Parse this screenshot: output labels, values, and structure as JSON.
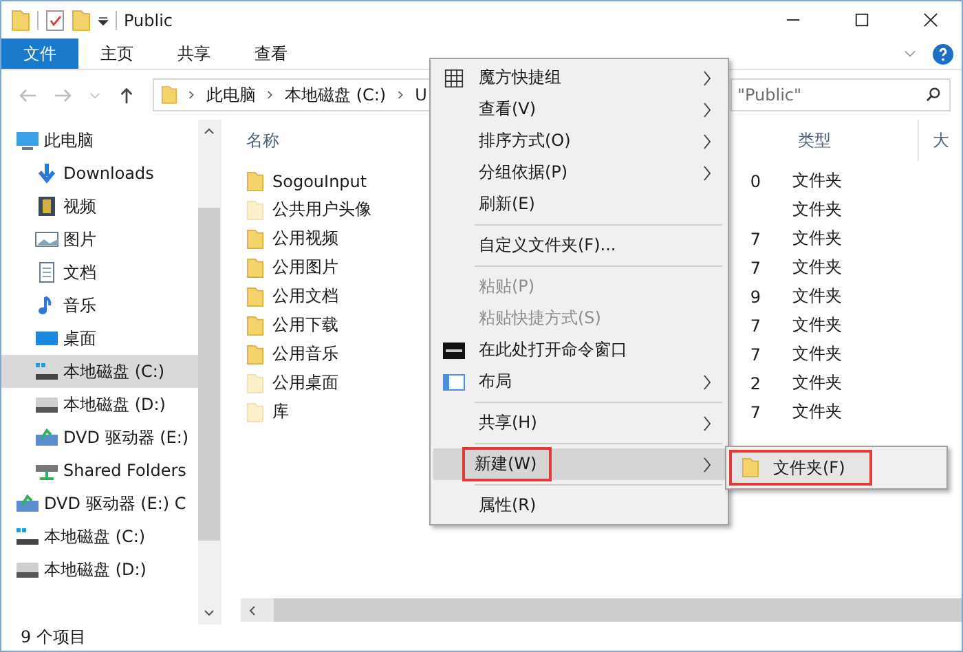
{
  "window": {
    "title": "Public"
  },
  "ribbon": {
    "tabs": [
      {
        "label": "文件",
        "kind": "file",
        "selected": false
      },
      {
        "label": "主页",
        "kind": "tab",
        "selected": false
      },
      {
        "label": "共享",
        "kind": "tab",
        "selected": false
      },
      {
        "label": "查看",
        "kind": "tab",
        "selected": false
      }
    ]
  },
  "address": {
    "crumbs": [
      "此电脑",
      "本地磁盘 (C:)",
      "U"
    ]
  },
  "search": {
    "placeholder": "\"Public\""
  },
  "sidebar": {
    "items": [
      {
        "label": "此电脑",
        "kind": "pc",
        "selected": false,
        "children": [
          {
            "label": "Downloads",
            "kind": "download",
            "selected": false
          },
          {
            "label": "视频",
            "kind": "video",
            "selected": false
          },
          {
            "label": "图片",
            "kind": "image",
            "selected": false
          },
          {
            "label": "文档",
            "kind": "doc",
            "selected": false
          },
          {
            "label": "音乐",
            "kind": "music",
            "selected": false
          },
          {
            "label": "桌面",
            "kind": "desktop",
            "selected": false
          },
          {
            "label": "本地磁盘 (C:)",
            "kind": "sysdrive",
            "selected": true
          },
          {
            "label": "本地磁盘 (D:)",
            "kind": "drive",
            "selected": false
          },
          {
            "label": "DVD 驱动器 (E:)",
            "kind": "dvd",
            "selected": false
          },
          {
            "label": "Shared Folders",
            "kind": "net",
            "selected": false
          }
        ]
      },
      {
        "label": "DVD 驱动器 (E:) C",
        "kind": "dvd",
        "selected": false
      },
      {
        "label": "本地磁盘 (C:)",
        "kind": "sysdrive",
        "selected": false
      },
      {
        "label": "本地磁盘 (D:)",
        "kind": "drive",
        "selected": false
      }
    ]
  },
  "columns": [
    "名称",
    "类型",
    "大"
  ],
  "rows": [
    {
      "name": "SogouInput",
      "date_tail": "0",
      "type": "文件夹",
      "hidden": false
    },
    {
      "name": "公共用户头像",
      "type": "文件夹",
      "hidden": true
    },
    {
      "name": "公用视频",
      "date_tail": "7",
      "type": "文件夹",
      "hidden": false
    },
    {
      "name": "公用图片",
      "date_tail": "7",
      "type": "文件夹",
      "hidden": false
    },
    {
      "name": "公用文档",
      "date_tail": "9",
      "type": "文件夹",
      "hidden": false
    },
    {
      "name": "公用下载",
      "date_tail": "7",
      "type": "文件夹",
      "hidden": false
    },
    {
      "name": "公用音乐",
      "date_tail": "7",
      "type": "文件夹",
      "hidden": false
    },
    {
      "name": "公用桌面",
      "date_tail": "2",
      "type": "文件夹",
      "hidden": true
    },
    {
      "name": "库",
      "date_tail": "7",
      "type": "文件夹",
      "hidden": true
    }
  ],
  "context_menu": {
    "items": [
      {
        "kind": "item",
        "label": "魔方快捷组",
        "submenu": true,
        "disabled": false,
        "highlighted": false
      },
      {
        "kind": "item",
        "label": "查看(V)",
        "submenu": true,
        "disabled": false,
        "highlighted": false
      },
      {
        "kind": "item",
        "label": "排序方式(O)",
        "submenu": true,
        "disabled": false,
        "highlighted": false
      },
      {
        "kind": "item",
        "label": "分组依据(P)",
        "submenu": true,
        "disabled": false,
        "highlighted": false
      },
      {
        "kind": "item",
        "label": "刷新(E)",
        "submenu": false,
        "disabled": false,
        "highlighted": false
      },
      {
        "kind": "separator"
      },
      {
        "kind": "item",
        "label": "自定义文件夹(F)...",
        "submenu": false,
        "disabled": false,
        "highlighted": false
      },
      {
        "kind": "separator"
      },
      {
        "kind": "item",
        "label": "粘贴(P)",
        "submenu": false,
        "disabled": true,
        "highlighted": false
      },
      {
        "kind": "item",
        "label": "粘贴快捷方式(S)",
        "submenu": false,
        "disabled": true,
        "highlighted": false
      },
      {
        "kind": "item",
        "label": "在此处打开命令窗口",
        "submenu": false,
        "disabled": false,
        "highlighted": false
      },
      {
        "kind": "item",
        "label": "布局",
        "submenu": true,
        "disabled": false,
        "highlighted": false
      },
      {
        "kind": "separator"
      },
      {
        "kind": "item",
        "label": "共享(H)",
        "submenu": true,
        "disabled": false,
        "highlighted": false
      },
      {
        "kind": "separator"
      },
      {
        "kind": "item",
        "label": "新建(W)",
        "submenu": true,
        "disabled": false,
        "highlighted": true
      },
      {
        "kind": "separator"
      },
      {
        "kind": "item",
        "label": "属性(R)",
        "submenu": false,
        "disabled": false,
        "highlighted": false
      }
    ]
  },
  "submenu": {
    "items": [
      {
        "label": "文件夹(F)",
        "highlighted": true
      }
    ]
  },
  "status_bar": {
    "text": "9 个项目"
  }
}
